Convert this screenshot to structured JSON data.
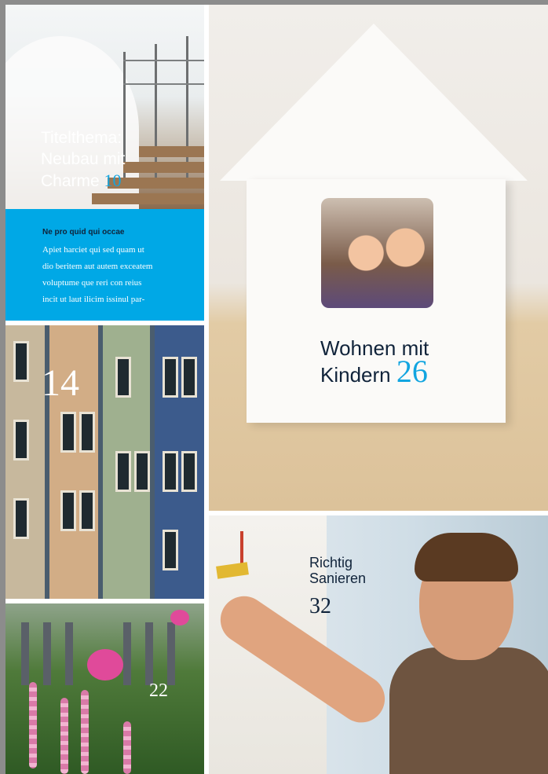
{
  "cover_story": {
    "title_lines": [
      "Titelthema:",
      "Neubau mit",
      "Charme"
    ],
    "page": "10"
  },
  "teaser": {
    "headline": "Ne pro quid qui occae",
    "lines": [
      "Apiet harciet qui sed quam ut",
      "dio beritem aut autem exceatem",
      "voluptume que reri con reius",
      "incit ut laut ilicim issinul par-"
    ]
  },
  "houses": {
    "page": "14"
  },
  "garden": {
    "page": "22"
  },
  "kids": {
    "title_lines": [
      "Wohnen mit",
      "Kindern"
    ],
    "page": "26"
  },
  "renovation": {
    "title_lines": [
      "Richtig",
      "Sanieren"
    ],
    "page": "32"
  },
  "colors": {
    "accent_blue": "#00a8e6",
    "number_blue": "#12a5e0",
    "dark_text": "#10233a"
  }
}
